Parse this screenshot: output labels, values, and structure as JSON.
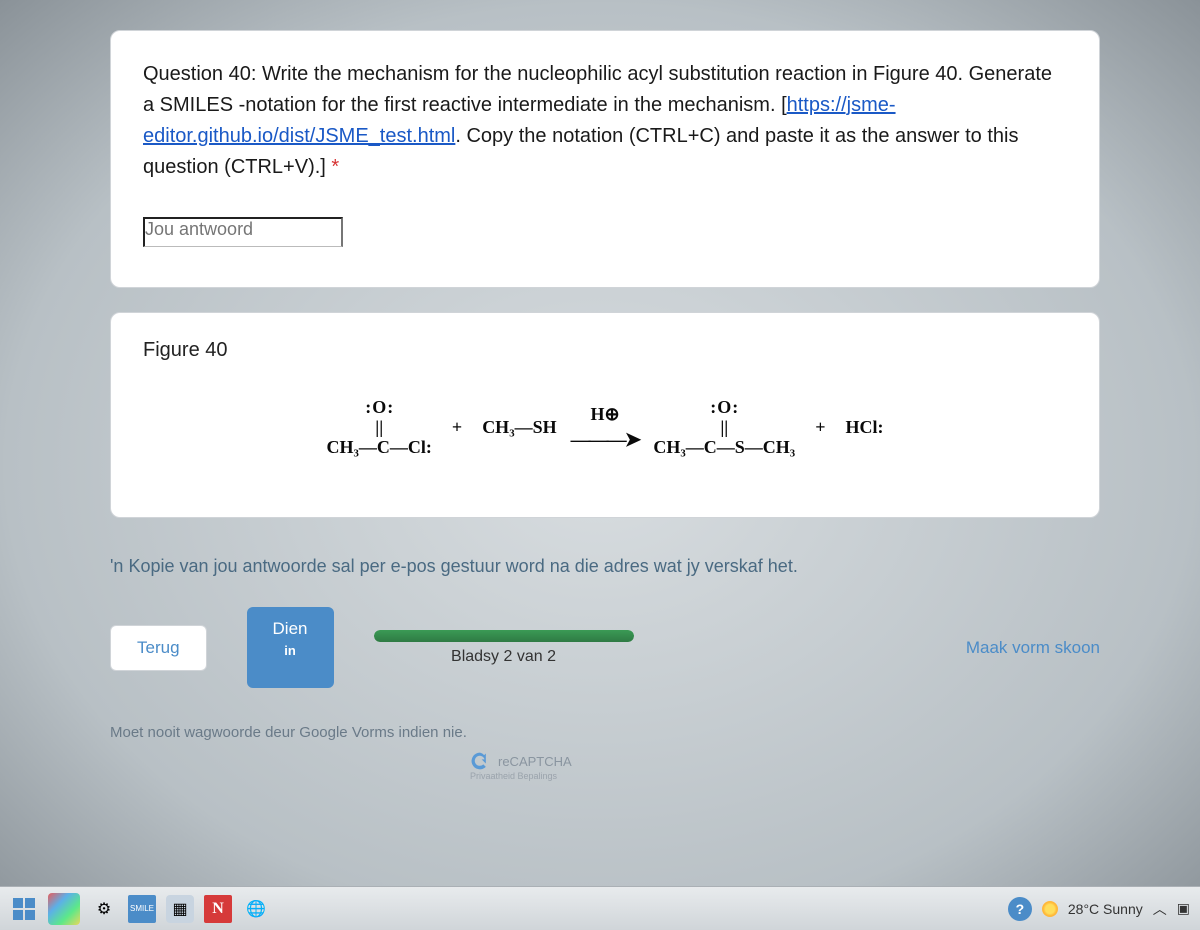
{
  "question": {
    "prefix": "Question 40: Write the mechanism for the nucleophilic acyl substitution reaction in Figure 40. Generate a SMILES -notation for the first reactive intermediate in the mechanism. [",
    "link_text": "https://jsme-editor.github.io/dist/JSME_test.html",
    "suffix": ". Copy the notation (CTRL+C) and paste it as the answer to this question (CTRL+V).]",
    "required_mark": "*"
  },
  "answer": {
    "placeholder": "Jou antwoord"
  },
  "figure": {
    "title": "Figure 40",
    "reactant1_top": "O",
    "reactant1_dbl": "||",
    "reactant1_main": "CH₃—C—Cl:",
    "plus1": "+",
    "reactant2": "CH₃—SH",
    "arrow_condition": "H⊕",
    "product_top": "O",
    "product_dbl": "||",
    "product_main": "CH₃—C—S—CH₃",
    "plus2": "+",
    "byproduct": "HCl:"
  },
  "email_note": "'n Kopie van jou antwoorde sal per e-pos gestuur word na die adres wat jy verskaf het.",
  "actions": {
    "back": "Terug",
    "submit": "Dien",
    "submit_sub": "in",
    "page_count": "Bladsy 2 van 2",
    "clear": "Maak vorm skoon",
    "progress_percent": 100
  },
  "warning": "Moet nooit wagwoorde deur Google Vorms indien nie.",
  "recaptcha": {
    "label": "reCAPTCHA",
    "sub": "Privaatheid Bepalings"
  },
  "taskbar": {
    "weather": "28°C Sunny"
  }
}
